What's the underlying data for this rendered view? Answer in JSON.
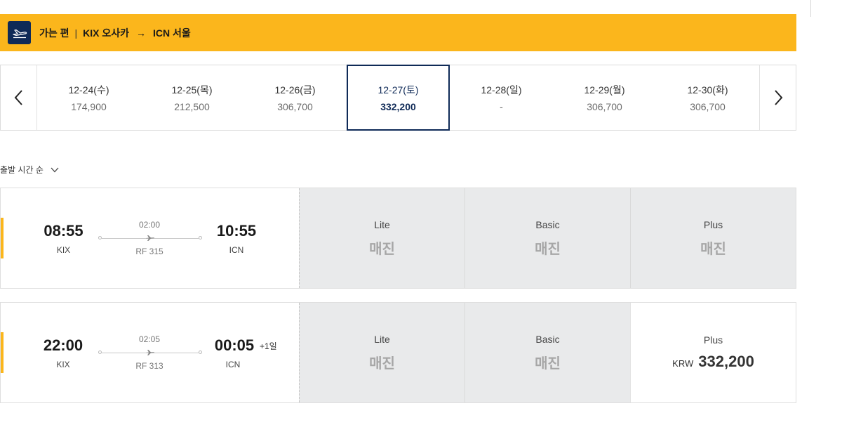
{
  "route": {
    "direction": "가는 편",
    "separator": "|",
    "origin": "KIX 오사카",
    "arrow": "→",
    "destination": "ICN 서울"
  },
  "dates": [
    {
      "date": "12-24(수)",
      "price": "174,900"
    },
    {
      "date": "12-25(목)",
      "price": "212,500"
    },
    {
      "date": "12-26(금)",
      "price": "306,700"
    },
    {
      "date": "12-27(토)",
      "price": "332,200",
      "selected": true
    },
    {
      "date": "12-28(일)",
      "price": "-"
    },
    {
      "date": "12-29(월)",
      "price": "306,700"
    },
    {
      "date": "12-30(화)",
      "price": "306,700"
    }
  ],
  "sort": {
    "label": "출발 시간 순"
  },
  "flights": [
    {
      "dep_time": "08:55",
      "dep_code": "KIX",
      "duration": "02:00",
      "flight_no": "RF 315",
      "arr_time": "10:55",
      "arr_code": "ICN",
      "day_offset": "",
      "fares": [
        {
          "class": "Lite",
          "status": "매진"
        },
        {
          "class": "Basic",
          "status": "매진"
        },
        {
          "class": "Plus",
          "status": "매진"
        }
      ]
    },
    {
      "dep_time": "22:00",
      "dep_code": "KIX",
      "duration": "02:05",
      "flight_no": "RF 313",
      "arr_time": "00:05",
      "arr_code": "ICN",
      "day_offset": "+1일",
      "fares": [
        {
          "class": "Lite",
          "status": "매진"
        },
        {
          "class": "Basic",
          "status": "매진"
        },
        {
          "class": "Plus",
          "currency": "KRW",
          "price": "332,200"
        }
      ]
    }
  ],
  "colors": {
    "accent": "#fbb61c",
    "navy": "#0f2a57",
    "soldout_bg": "#e9eaeb"
  }
}
